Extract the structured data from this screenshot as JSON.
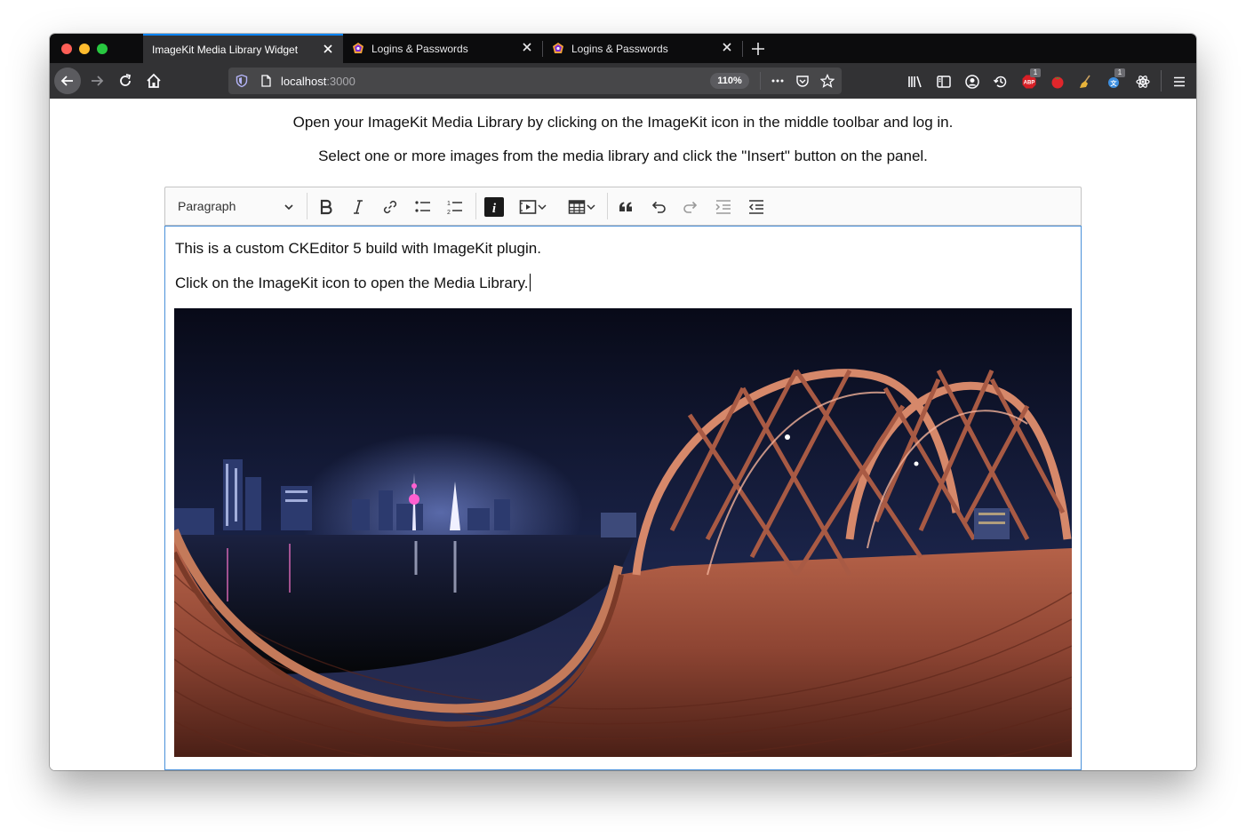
{
  "browser": {
    "tabs": [
      {
        "label": "ImageKit Media Library Widget",
        "active": true
      },
      {
        "label": "Logins & Passwords",
        "active": false
      },
      {
        "label": "Logins & Passwords",
        "active": false
      }
    ],
    "url_host": "localhost",
    "url_port": ":3000",
    "zoom": "110%",
    "badges": {
      "adblock": "1",
      "ext": "1"
    },
    "colors": {
      "accent": "#0a84ff",
      "tabstrip": "#0c0c0d",
      "navbar": "#323234"
    }
  },
  "page": {
    "intro_line1": "Open your ImageKit Media Library by clicking on the ImageKit icon in the middle toolbar and log in.",
    "intro_line2": "Select one or more images from the media library and click the \"Insert\" button on the panel."
  },
  "editor": {
    "heading_select": "Paragraph",
    "toolbar_icons": [
      "bold-icon",
      "italic-icon",
      "link-icon",
      "bulleted-list-icon",
      "numbered-list-icon",
      "imagekit-icon",
      "media-embed-icon",
      "table-icon",
      "blockquote-icon",
      "undo-icon",
      "redo-icon",
      "indent-icon",
      "outdent-icon"
    ],
    "paragraph1": "This is a custom CKEditor 5 build with ImageKit plugin.",
    "paragraph2": "Click on the ImageKit icon to open the Media Library."
  }
}
